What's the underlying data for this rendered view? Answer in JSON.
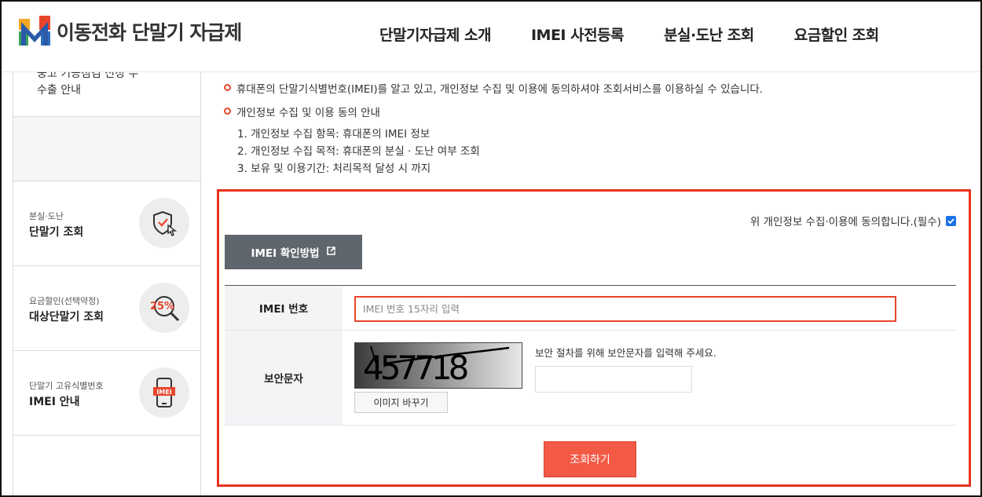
{
  "header": {
    "logo_text": "이동전화 단말기 자급제",
    "nav": [
      {
        "label": "단말기자급제 소개"
      },
      {
        "label": "IMEI 사전등록"
      },
      {
        "label": "분실·도난 조회"
      },
      {
        "label": "요금할인 조회"
      }
    ]
  },
  "sidebar": {
    "top_partial": "중고 기능점검 신청 수",
    "top_label": "수출 안내",
    "cards": [
      {
        "sub": "분실·도난",
        "main": "단말기 조회",
        "icon": "shield-cursor-icon"
      },
      {
        "sub": "요금할인(선택약정)",
        "main": "대상단말기 조회",
        "icon": "magnifier-discount-icon",
        "badge": "25%"
      },
      {
        "sub": "단말기 고유식별번호",
        "main": "IMEI 안내",
        "icon": "phone-imei-icon",
        "badge": "IMEI"
      }
    ]
  },
  "content": {
    "notice_1": "휴대폰의 단말기식별번호(IMEI)를 알고 있고, 개인정보 수집 및 이용에 동의하셔야 조회서비스를 이용하실 수 있습니다.",
    "notice_2": "개인정보 수집 및 이용 동의 안내",
    "list": [
      "1. 개인정보 수집 항목: 휴대폰의 IMEI 정보",
      "2. 개인정보 수집 목적: 휴대폰의 분실 · 도난 여부 조회",
      "3. 보유 및 이용기간: 처리목적 달성 시 까지"
    ]
  },
  "form": {
    "agree_label": "위 개인정보 수집·이용에 동의합니다.(필수)",
    "agree_checked": true,
    "imei_how_label": "IMEI 확인방법",
    "imei_label": "IMEI 번호",
    "imei_placeholder": "IMEI 번호 15자리 입력",
    "captcha_label": "보안문자",
    "captcha_text": "457718",
    "change_image_label": "이미지 바꾸기",
    "captcha_guide": "보안 절차를 위해 보안문자를 입력해 주세요.",
    "submit_label": "조회하기"
  },
  "colors": {
    "accent": "#e8331f",
    "button_dark": "#5f666d",
    "submit": "#f25a45",
    "checkbox": "#1a73e8"
  }
}
